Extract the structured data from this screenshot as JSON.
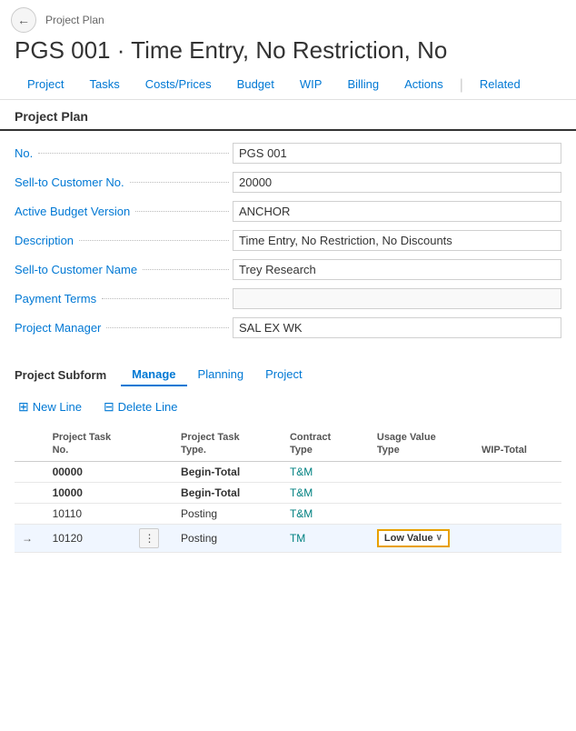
{
  "breadcrumb": "Project Plan",
  "page_title": "PGS 001 · Time Entry, No Restriction, No",
  "nav_tabs": [
    {
      "label": "Project",
      "active": false
    },
    {
      "label": "Tasks",
      "active": false
    },
    {
      "label": "Costs/Prices",
      "active": false
    },
    {
      "label": "Budget",
      "active": false
    },
    {
      "label": "WIP",
      "active": false
    },
    {
      "label": "Billing",
      "active": false
    },
    {
      "label": "Actions",
      "active": false
    },
    {
      "label": "Related",
      "active": false
    }
  ],
  "section_title": "Project Plan",
  "fields": [
    {
      "label": "No.",
      "value": "PGS 001",
      "empty": false
    },
    {
      "label": "Sell-to Customer No.",
      "value": "20000",
      "empty": false
    },
    {
      "label": "Active Budget Version",
      "value": "ANCHOR",
      "empty": false
    },
    {
      "label": "Description",
      "value": "Time Entry, No Restriction, No Discounts",
      "empty": false
    },
    {
      "label": "Sell-to Customer Name",
      "value": "Trey Research",
      "empty": false
    },
    {
      "label": "Payment Terms",
      "value": "",
      "empty": true
    },
    {
      "label": "Project Manager",
      "value": "SAL EX WK",
      "empty": false
    }
  ],
  "subform": {
    "title": "Project Subform",
    "tabs": [
      {
        "label": "Manage",
        "active": true
      },
      {
        "label": "Planning",
        "active": false
      },
      {
        "label": "Project",
        "active": false
      }
    ]
  },
  "toolbar": {
    "new_line": "New Line",
    "delete_line": "Delete Line"
  },
  "table": {
    "headers": [
      {
        "label": "Project Task\nNo.",
        "key": "task_no"
      },
      {
        "label": "",
        "key": "dots"
      },
      {
        "label": "Project Task\nType.",
        "key": "task_type"
      },
      {
        "label": "Contract\nType",
        "key": "contract_type"
      },
      {
        "label": "Usage Value\nType",
        "key": "usage_value"
      },
      {
        "label": "WIP-Total",
        "key": "wip_total"
      }
    ],
    "rows": [
      {
        "indicator": "",
        "task_no": "00000",
        "task_no_bold": true,
        "dots": false,
        "task_type": "Begin-Total",
        "task_type_bold": true,
        "contract_type": "T&M",
        "usage_value": "",
        "wip_total": "",
        "arrow": false
      },
      {
        "indicator": "",
        "task_no": "10000",
        "task_no_bold": true,
        "dots": false,
        "task_type": "Begin-Total",
        "task_type_bold": true,
        "contract_type": "T&M",
        "usage_value": "",
        "wip_total": "",
        "arrow": false
      },
      {
        "indicator": "",
        "task_no": "10110",
        "task_no_bold": false,
        "dots": false,
        "task_type": "Posting",
        "task_type_bold": false,
        "contract_type": "T&M",
        "usage_value": "",
        "wip_total": "",
        "arrow": false
      },
      {
        "indicator": "→",
        "task_no": "10120",
        "task_no_bold": false,
        "dots": true,
        "task_type": "Posting",
        "task_type_bold": false,
        "contract_type": "TM",
        "usage_value": "Low Value",
        "wip_total": "",
        "arrow": true,
        "selected": true
      }
    ]
  },
  "icons": {
    "back": "←",
    "new_line_icon": "⊞",
    "delete_line_icon": "⊟",
    "dots": "⋮",
    "arrow_right": "→",
    "chevron_down": "∨"
  }
}
